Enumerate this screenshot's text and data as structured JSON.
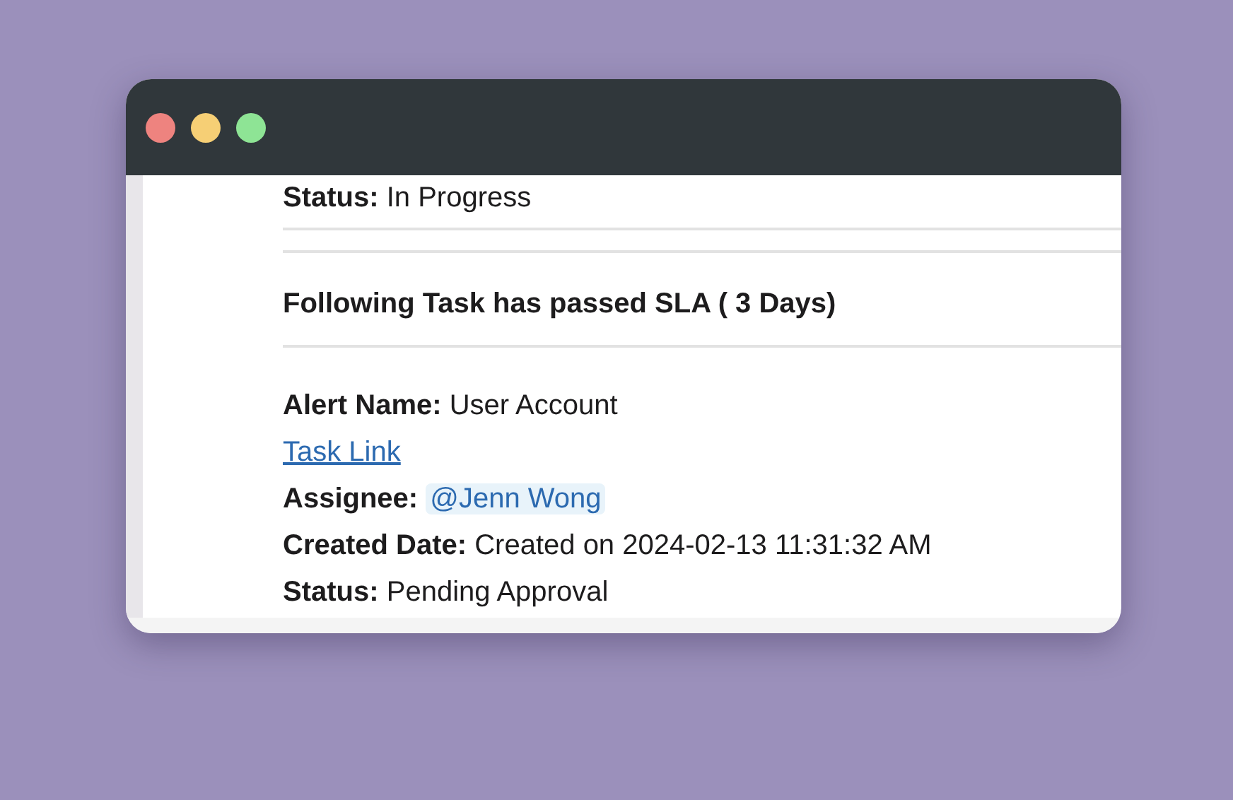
{
  "window": {
    "controls": [
      {
        "color": "#ee837f"
      },
      {
        "color": "#f6cf75"
      },
      {
        "color": "#8ee495"
      }
    ]
  },
  "previous": {
    "lines": [
      {
        "kind": "field",
        "text": "**Status:** In Progress"
      }
    ]
  },
  "task": {
    "heading": "Following Task has passed SLA ( 3 Days)",
    "lines": [
      {
        "kind": "field",
        "text": "**Alert Name:** User Account"
      },
      {
        "kind": "link",
        "text": "Task Link"
      },
      {
        "kind": "mention",
        "label": "Assignee:",
        "value": "@Jenn Wong"
      },
      {
        "kind": "field",
        "text": "**Created Date:** Created on 2024-02-13 11:31:32 AM"
      },
      {
        "kind": "field",
        "text": "**Status:** Pending Approval"
      }
    ]
  }
}
